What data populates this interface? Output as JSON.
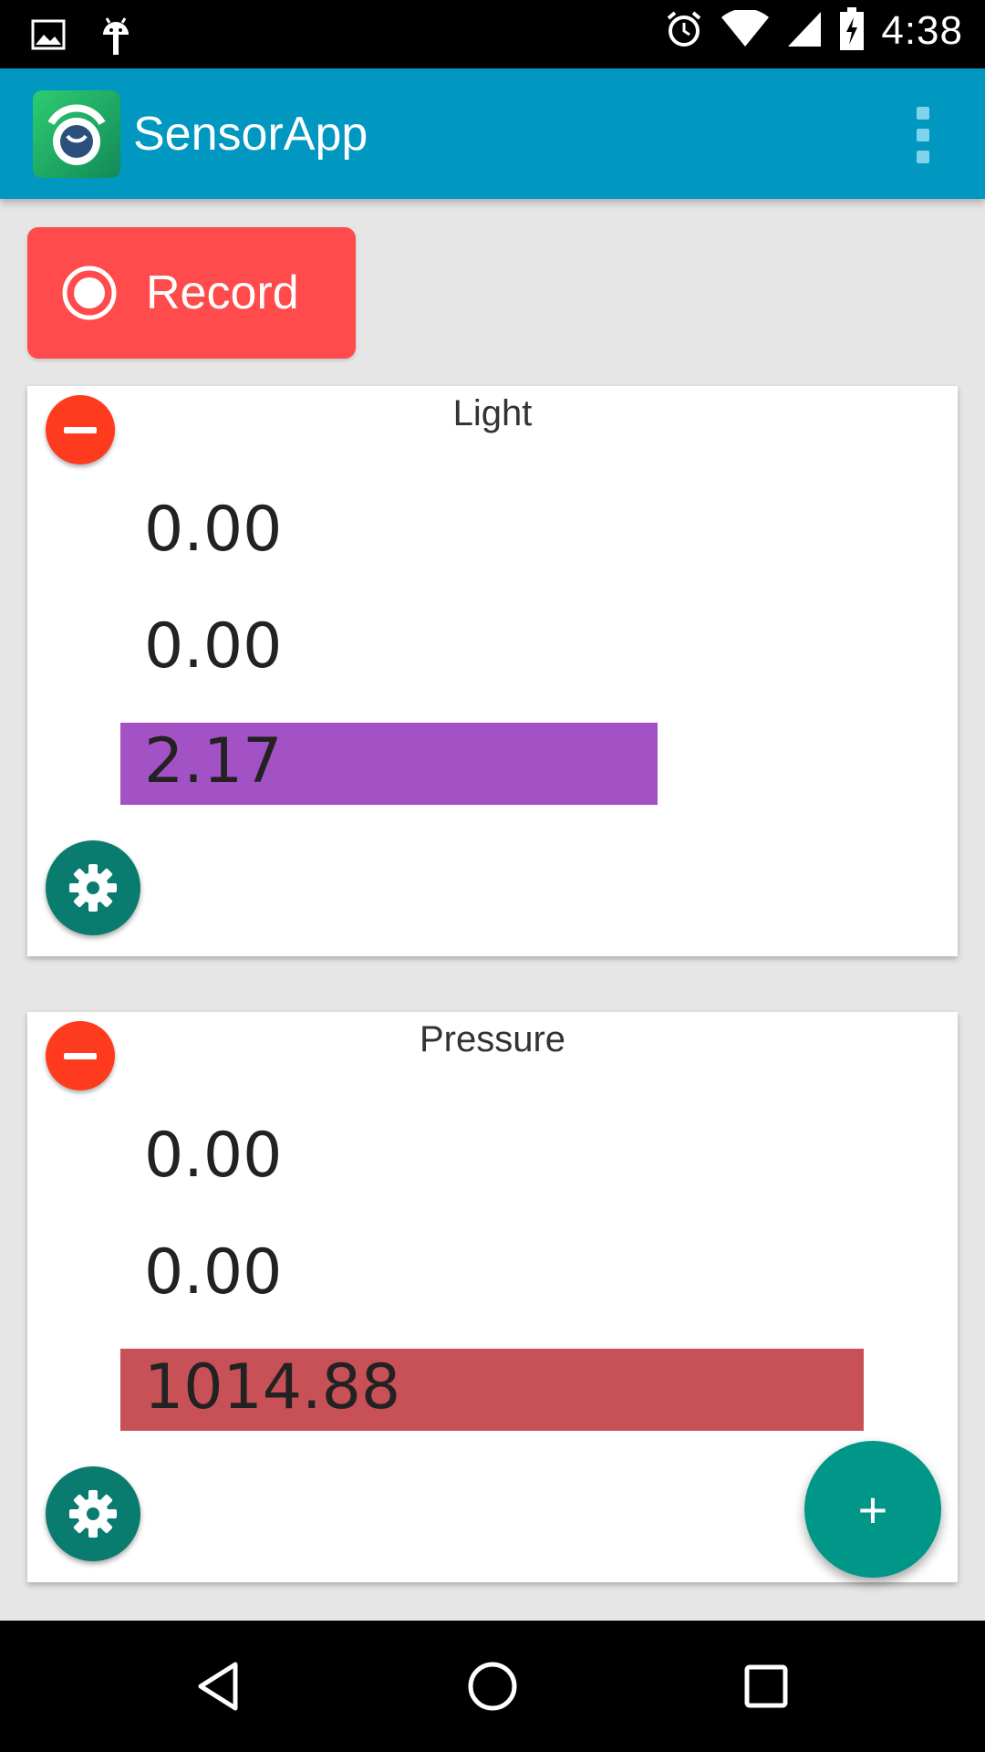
{
  "status_bar": {
    "time": "4:38",
    "icons": [
      "image-notification-icon",
      "android-notification-icon",
      "alarm-icon",
      "wifi-icon",
      "cell-signal-icon",
      "battery-charging-icon"
    ]
  },
  "app_bar": {
    "title": "SensorApp",
    "color": "#0097c0"
  },
  "record_button": {
    "label": "Record",
    "color": "#ff4b4b"
  },
  "sensors": [
    {
      "name": "Light",
      "value1": "0.00",
      "value2": "0.00",
      "bar_value": "2.17",
      "bar_color": "#a352c6"
    },
    {
      "name": "Pressure",
      "value1": "0.00",
      "value2": "0.00",
      "bar_value": "1014.88",
      "bar_color": "#c85057"
    }
  ],
  "fab": {
    "label": "+",
    "color": "#009688"
  },
  "nav_bar": {
    "items": [
      "back-icon",
      "home-icon",
      "recents-icon"
    ]
  }
}
